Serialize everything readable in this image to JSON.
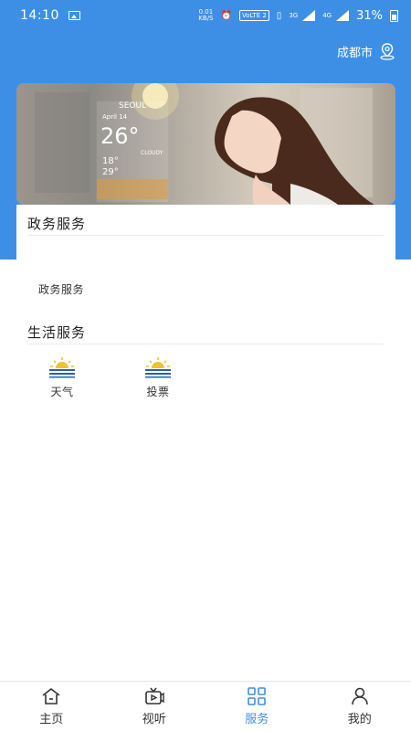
{
  "status_bar": {
    "time": "14:10",
    "net_speed_value": "0.01",
    "net_speed_unit": "KB/S",
    "volte": "VoLTE 2",
    "net_3g": "3G",
    "net_4g": "4G",
    "battery": "31%"
  },
  "header": {
    "city": "成都市",
    "accent_color": "#3d8fe6"
  },
  "banner": {
    "city_label": "SEOUL",
    "date_label": "April 14",
    "temperature": "26°",
    "status_label": "CLOUDY",
    "low": "18°",
    "high": "29°"
  },
  "gov_section": {
    "title": "政务服务",
    "items": [
      {
        "label": "政务服务"
      }
    ]
  },
  "life_section": {
    "title": "生活服务",
    "items": [
      {
        "label": "天气",
        "icon": "sunrise-icon"
      },
      {
        "label": "投票",
        "icon": "sunrise-icon"
      }
    ]
  },
  "bottom_nav": {
    "items": [
      {
        "label": "主页",
        "icon": "home-icon",
        "active": false
      },
      {
        "label": "视听",
        "icon": "tv-icon",
        "active": false
      },
      {
        "label": "服务",
        "icon": "grid-icon",
        "active": true
      },
      {
        "label": "我的",
        "icon": "user-icon",
        "active": false
      }
    ]
  }
}
